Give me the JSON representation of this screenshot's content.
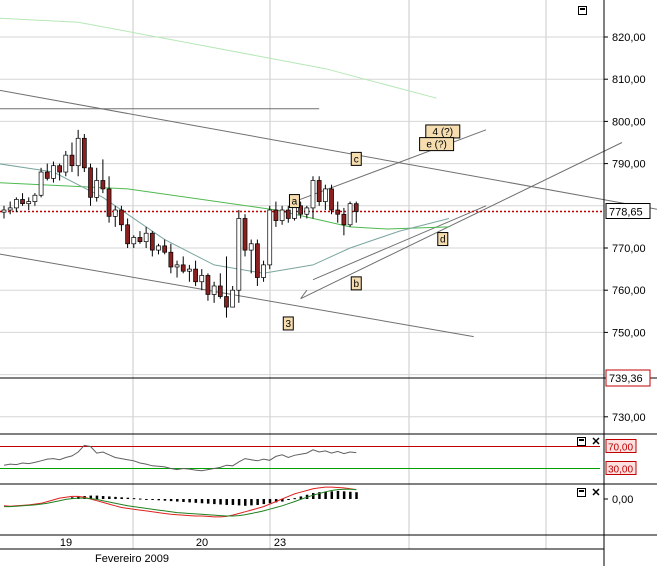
{
  "chart_data": [
    {
      "type": "candlestick",
      "name": "price",
      "x_tick_labels": [
        "19",
        "20",
        "23"
      ],
      "x_group_label": "Fevereiro 2009",
      "y_ticks": [
        820,
        810,
        800,
        790,
        780,
        770,
        760,
        750,
        740,
        730
      ],
      "y_tick_labels": [
        "820,00",
        "810,00",
        "800,00",
        "790,00",
        "770,00",
        "760,00",
        "750,00",
        "730,00"
      ],
      "ylim": [
        722,
        826
      ],
      "last_price_label": "778,65",
      "last_price": 778.65,
      "ref_level_label": "739,36",
      "ref_level": 739.36,
      "candles": [
        [
          778.5,
          780.0,
          777.0,
          779.0
        ],
        [
          779.0,
          781.0,
          778.0,
          779.5
        ],
        [
          779.5,
          782.0,
          778.5,
          781.5
        ],
        [
          781.5,
          783.0,
          780.0,
          780.5
        ],
        [
          780.5,
          782.0,
          779.0,
          781.0
        ],
        [
          781.0,
          783.0,
          780.0,
          782.5
        ],
        [
          782.5,
          789.0,
          782.0,
          788.0
        ],
        [
          788.0,
          790.0,
          786.0,
          786.5
        ],
        [
          786.5,
          790.5,
          785.5,
          789.5
        ],
        [
          789.5,
          790.0,
          786.0,
          788.0
        ],
        [
          788.0,
          793.0,
          787.0,
          792.0
        ],
        [
          792.0,
          795.0,
          788.0,
          789.5
        ],
        [
          789.5,
          798.0,
          787.0,
          796.0
        ],
        [
          796.0,
          797.0,
          788.0,
          789.0
        ],
        [
          789.0,
          790.0,
          780.0,
          782.0
        ],
        [
          782.0,
          789.0,
          781.0,
          786.0
        ],
        [
          786.0,
          791.0,
          783.0,
          784.0
        ],
        [
          784.0,
          787.0,
          776.0,
          777.5
        ],
        [
          777.5,
          780.0,
          775.0,
          779.0
        ],
        [
          779.0,
          780.0,
          774.0,
          775.5
        ],
        [
          775.5,
          777.0,
          770.0,
          771.0
        ],
        [
          771.0,
          773.0,
          770.0,
          772.5
        ],
        [
          772.5,
          774.0,
          771.0,
          771.5
        ],
        [
          771.5,
          775.0,
          770.0,
          773.5
        ],
        [
          773.5,
          774.0,
          768.0,
          769.5
        ],
        [
          769.5,
          771.0,
          768.5,
          770.5
        ],
        [
          770.5,
          772.0,
          768.5,
          769.0
        ],
        [
          769.0,
          771.0,
          764.0,
          765.5
        ],
        [
          765.5,
          767.0,
          763.0,
          766.0
        ],
        [
          766.0,
          768.0,
          764.0,
          764.5
        ],
        [
          764.5,
          766.0,
          762.0,
          765.0
        ],
        [
          765.0,
          767.0,
          761.0,
          762.0
        ],
        [
          762.0,
          765.0,
          760.0,
          763.5
        ],
        [
          763.5,
          764.0,
          757.5,
          759.0
        ],
        [
          759.0,
          762.0,
          757.0,
          761.0
        ],
        [
          761.0,
          764.0,
          758.0,
          758.5
        ],
        [
          758.5,
          768.0,
          753.5,
          756.0
        ],
        [
          756.0,
          761.0,
          756.0,
          760.0
        ],
        [
          760.0,
          779.0,
          757.0,
          777.0
        ],
        [
          777.0,
          778.0,
          768.0,
          769.5
        ],
        [
          769.5,
          772.0,
          764.0,
          771.0
        ],
        [
          771.0,
          772.0,
          761.0,
          763.0
        ],
        [
          763.0,
          767.0,
          762.0,
          766.0
        ],
        [
          766.0,
          780.0,
          765.0,
          779.0
        ],
        [
          779.0,
          781.0,
          775.0,
          776.5
        ],
        [
          776.5,
          780.0,
          775.5,
          779.0
        ],
        [
          779.0,
          780.0,
          776.0,
          777.0
        ],
        [
          777.0,
          781.0,
          776.5,
          780.0
        ],
        [
          780.0,
          781.0,
          777.0,
          778.0
        ],
        [
          778.0,
          780.0,
          777.0,
          779.5
        ],
        [
          779.5,
          787.0,
          777.0,
          786.0
        ],
        [
          786.0,
          787.0,
          780.0,
          781.0
        ],
        [
          781.0,
          785.0,
          779.0,
          784.0
        ],
        [
          784.0,
          785.0,
          778.0,
          779.0
        ],
        [
          779.0,
          781.0,
          776.0,
          778.0
        ],
        [
          778.0,
          779.5,
          773.0,
          775.5
        ],
        [
          775.5,
          781.0,
          775.0,
          780.5
        ],
        [
          780.5,
          781.0,
          776.0,
          778.65
        ]
      ],
      "lines": [
        {
          "color": "#b6e8b6",
          "points": [
            [
              -22,
              826
            ],
            [
              12,
              823.5
            ],
            [
              32,
              818
            ],
            [
              52,
              812.5
            ],
            [
              70,
              805.5
            ]
          ]
        },
        {
          "color": "#4fb94f",
          "points": [
            [
              -22,
              789
            ],
            [
              -8,
              786
            ],
            [
              20,
              784
            ],
            [
              44,
              779
            ],
            [
              56,
              775
            ],
            [
              62,
              774.5
            ],
            [
              72,
              775
            ]
          ]
        },
        {
          "color": "#7ba5a0",
          "points": [
            [
              -22,
              795
            ],
            [
              -10,
              792
            ],
            [
              8,
              788
            ],
            [
              16,
              782
            ],
            [
              26,
              772
            ],
            [
              34,
              766
            ],
            [
              42,
              764
            ],
            [
              50,
              766
            ],
            [
              56,
              770
            ],
            [
              64,
              774
            ],
            [
              72,
              777
            ]
          ]
        }
      ],
      "annotations": [
        {
          "label": "a",
          "x": 47,
          "y": 781
        },
        {
          "label": "3",
          "x": 46,
          "y": 752
        },
        {
          "label": "b",
          "x": 57,
          "y": 761.5
        },
        {
          "label": "c",
          "x": 57,
          "y": 791
        },
        {
          "label": "d",
          "x": 71,
          "y": 772
        },
        {
          "label": "4 (?)",
          "x": 71,
          "y": 797.5
        },
        {
          "label": "e (?)",
          "x": 70,
          "y": 794.5
        }
      ],
      "trend_lines": [
        {
          "from": [
            -22,
            813
          ],
          "to": [
            112,
            777.5
          ]
        },
        {
          "from": [
            -22,
            774
          ],
          "to": [
            76,
            749
          ]
        },
        {
          "from": [
            47,
            781
          ],
          "to": [
            78,
            798
          ]
        },
        {
          "from": [
            48,
            758
          ],
          "to": [
            100,
            795
          ]
        },
        {
          "from": [
            48,
            758
          ],
          "to": [
            49,
            760
          ]
        },
        {
          "from": [
            50,
            762.5
          ],
          "to": [
            78,
            780
          ]
        },
        {
          "from": [
            -22,
            803
          ],
          "to": [
            51,
            803
          ]
        }
      ]
    },
    {
      "type": "line",
      "name": "rsi",
      "levels": [
        30,
        70
      ],
      "level_labels": [
        "30,00",
        "70,00"
      ],
      "values": [
        36,
        38,
        37,
        40,
        39,
        41,
        44,
        47,
        48,
        46,
        50,
        53,
        60,
        72,
        70,
        58,
        60,
        55,
        50,
        48,
        46,
        44,
        40,
        38,
        35,
        34,
        33,
        30,
        28,
        30,
        29,
        27,
        26,
        28,
        30,
        32,
        36,
        35,
        42,
        48,
        46,
        44,
        47,
        45,
        52,
        55,
        50,
        54,
        56,
        58,
        64,
        60,
        62,
        58,
        61,
        57,
        60,
        59
      ]
    },
    {
      "type": "bar+line",
      "name": "macd",
      "zero_label": "0,00",
      "histogram": [
        0,
        0,
        0,
        0,
        0,
        0,
        0,
        0,
        0,
        0,
        0,
        0.2,
        0.3,
        0.35,
        0.4,
        0.4,
        0.35,
        0.3,
        0.25,
        0.2,
        0.15,
        0.1,
        0.05,
        -0.05,
        -0.1,
        -0.15,
        -0.2,
        -0.25,
        -0.3,
        -0.35,
        -0.4,
        -0.45,
        -0.5,
        -0.55,
        -0.6,
        -0.65,
        -0.7,
        -0.7,
        -0.75,
        -0.8,
        -0.75,
        -0.7,
        -0.6,
        -0.5,
        -0.4,
        -0.3,
        -0.1,
        0.1,
        0.3,
        0.5,
        0.7,
        0.8,
        0.85,
        0.9,
        0.95,
        0.9,
        0.85,
        0.8
      ],
      "macd_line": [
        -0.8,
        -0.85,
        -0.8,
        -0.75,
        -0.7,
        -0.6,
        -0.5,
        -0.3,
        -0.1,
        0.1,
        0.2,
        0.3,
        0.3,
        0.2,
        0.0,
        -0.2,
        -0.4,
        -0.6,
        -0.8,
        -1.0,
        -1.1,
        -1.2,
        -1.3,
        -1.4,
        -1.5,
        -1.6,
        -1.7,
        -1.8,
        -1.85,
        -1.9,
        -1.95,
        -2.0,
        -2.0,
        -2.05,
        -2.1,
        -2.1,
        -2.05,
        -1.9,
        -1.7,
        -1.5,
        -1.3,
        -1.1,
        -0.9,
        -0.6,
        -0.3,
        0.0,
        0.3,
        0.6,
        0.8,
        1.0,
        1.2,
        1.3,
        1.4,
        1.4,
        1.35,
        1.3,
        1.2,
        1.1
      ],
      "signal_line": [
        -0.9,
        -0.9,
        -0.85,
        -0.8,
        -0.75,
        -0.7,
        -0.6,
        -0.5,
        -0.35,
        -0.2,
        -0.05,
        0.05,
        0.1,
        0.1,
        0.05,
        -0.05,
        -0.2,
        -0.35,
        -0.5,
        -0.65,
        -0.8,
        -0.9,
        -1.0,
        -1.1,
        -1.2,
        -1.3,
        -1.4,
        -1.5,
        -1.6,
        -1.65,
        -1.7,
        -1.75,
        -1.8,
        -1.85,
        -1.9,
        -1.95,
        -2.0,
        -2.0,
        -1.95,
        -1.85,
        -1.7,
        -1.55,
        -1.4,
        -1.2,
        -1.0,
        -0.8,
        -0.55,
        -0.3,
        -0.05,
        0.2,
        0.45,
        0.65,
        0.85,
        1.0,
        1.1,
        1.15,
        1.15,
        1.1
      ]
    }
  ],
  "colors": {
    "up": "#ffffff",
    "down": "#8b2020",
    "last_price_line": "#c00000",
    "rsi_line": "#606060",
    "rsi_upper": "#c00000",
    "rsi_lower": "#00a000",
    "macd_line": "#e02020",
    "signal_line": "#208020",
    "histogram": "#000000",
    "annotation_fill": "#f5ddb0"
  },
  "icons": [
    "maximize-icon",
    "close-icon"
  ]
}
